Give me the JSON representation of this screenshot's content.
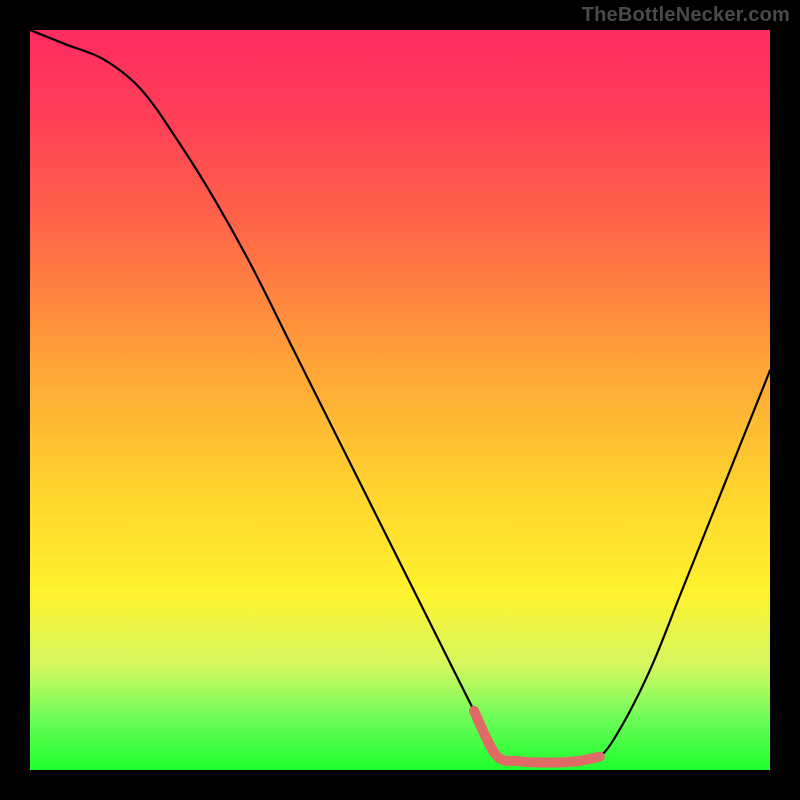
{
  "watermark": {
    "text": "TheBottleNecker.com"
  },
  "colors": {
    "stage_bg": "#000000",
    "curve_stroke": "#000000",
    "bottom_highlight": "#e06a66",
    "gradient_stops": [
      "#ff2c62",
      "#ff3f57",
      "#ff6a46",
      "#ffa338",
      "#ffd32e",
      "#fff22e",
      "#d4f761",
      "#6dfc58",
      "#1dff2e"
    ]
  },
  "chart_data": {
    "type": "line",
    "title": "",
    "xlabel": "",
    "ylabel": "",
    "xlim": [
      0,
      100
    ],
    "ylim": [
      0,
      100
    ],
    "series": [
      {
        "name": "left_branch",
        "x": [
          0,
          5,
          10,
          15,
          20,
          25,
          30,
          35,
          40,
          45,
          50,
          55,
          60,
          63
        ],
        "values": [
          100,
          98,
          96,
          92,
          85,
          77,
          68,
          58,
          48,
          38,
          28,
          18,
          8,
          2
        ]
      },
      {
        "name": "bottom_flat",
        "x": [
          63,
          66,
          70,
          74,
          77
        ],
        "values": [
          2,
          1.2,
          1.0,
          1.2,
          1.8
        ]
      },
      {
        "name": "right_branch",
        "x": [
          77,
          80,
          84,
          88,
          92,
          96,
          100
        ],
        "values": [
          1.8,
          6,
          14,
          24,
          34,
          44,
          54
        ]
      }
    ],
    "annotations": [
      {
        "name": "highlighted_minimum_segment",
        "x_range": [
          60,
          77
        ],
        "note": "pink/red thick stroke at curve minimum"
      }
    ]
  }
}
